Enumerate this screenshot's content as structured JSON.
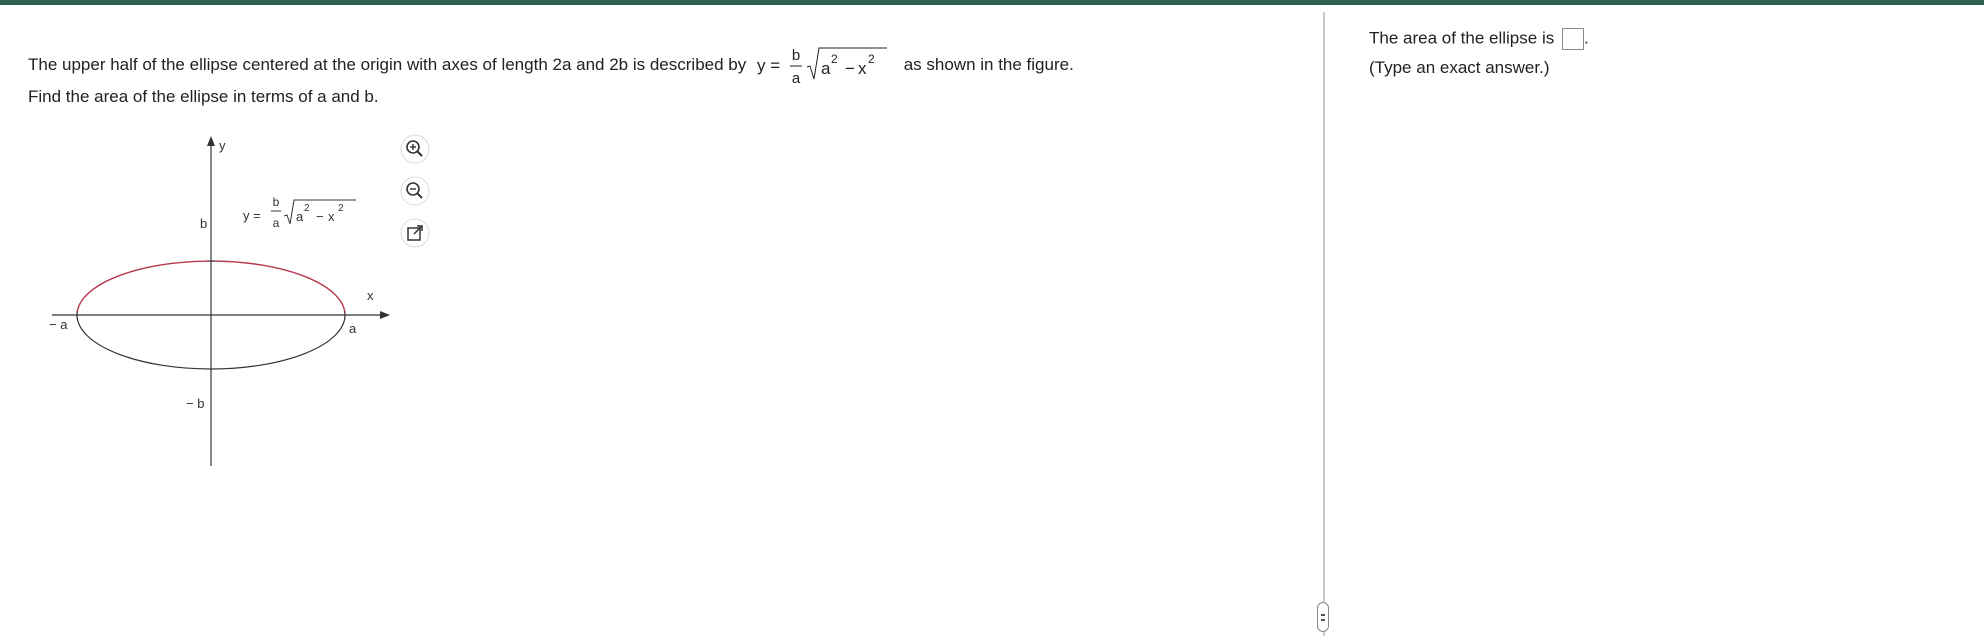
{
  "question": {
    "line1_prefix": "The upper half of the ellipse centered at the origin with axes of length 2a and 2b is described by",
    "line1_suffix": "as shown in the figure.",
    "line2": "Find the area of the ellipse in terms of a and b.",
    "formula": {
      "lhs": "y =",
      "num": "b",
      "den": "a",
      "radicand_a": "a",
      "exp_a": "2",
      "minus": "−",
      "radicand_x": "x",
      "exp_x": "2"
    }
  },
  "figure": {
    "y_axis_label": "y",
    "x_axis_label": "x",
    "label_b": "b",
    "label_neg_b": "− b",
    "label_a": "a",
    "label_neg_a": "− a",
    "curve_formula": {
      "lhs": "y =",
      "num": "b",
      "den": "a",
      "radicand_a": "a",
      "exp_a": "2",
      "minus": "−",
      "radicand_x": "x",
      "exp_x": "2"
    },
    "upper_curve_color": "#b5394f",
    "lower_curve_color": "#333333"
  },
  "tools": [
    "zoom-in-icon",
    "zoom-out-icon",
    "popout-icon"
  ],
  "answer": {
    "prompt": "The area of the ellipse is",
    "period": ".",
    "note": "(Type an exact answer.)"
  },
  "colors": {
    "topbar": "#2e6150",
    "divider": "#c9c9c9"
  }
}
